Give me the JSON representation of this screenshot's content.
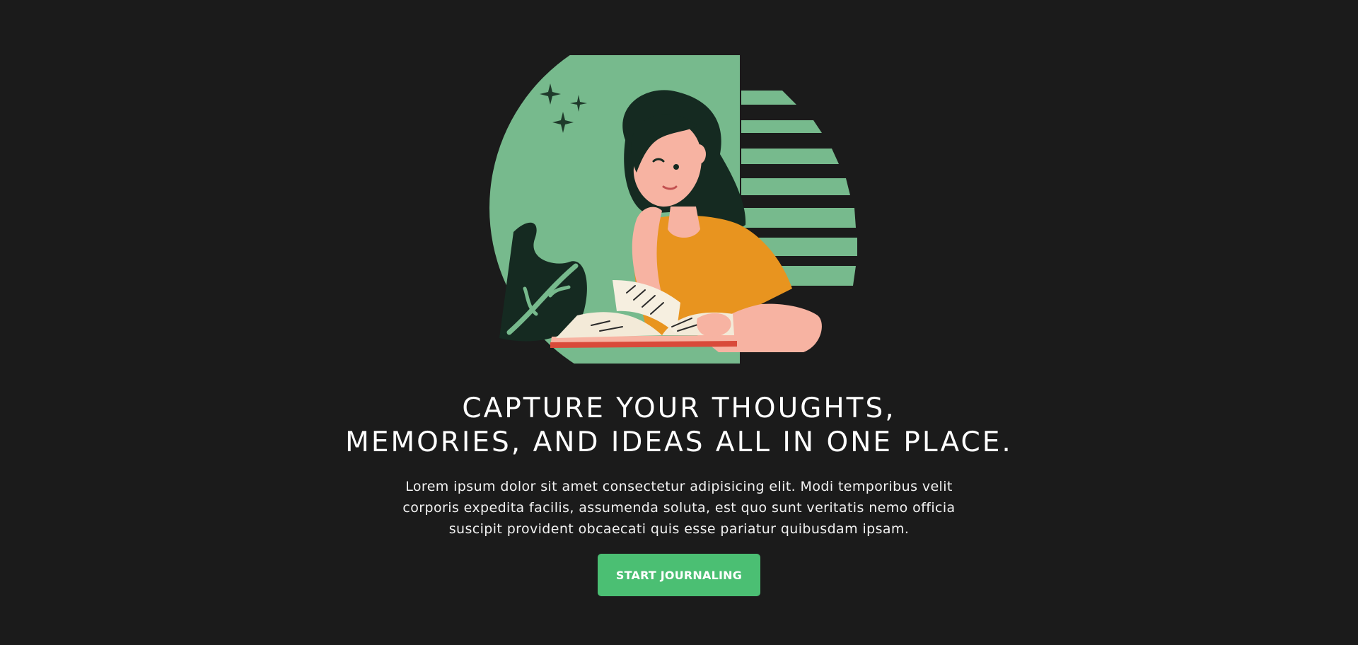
{
  "hero": {
    "headline_line1": "CAPTURE YOUR THOUGHTS,",
    "headline_line2": "MEMORIES, AND IDEAS ALL IN ONE PLACE.",
    "description": "Lorem ipsum dolor sit amet consectetur adipisicing elit. Modi temporibus velit corporis expedita facilis, assumenda soluta, est quo sunt veritatis nemo officia suscipit provident obcaecati quis esse pariatur quibusdam ipsam.",
    "cta_label": "START JOURNALING"
  },
  "illustration": {
    "subject": "woman-reading-journal",
    "icons": [
      "sparkle-icon",
      "leaf-icon"
    ]
  },
  "colors": {
    "background": "#1b1b1b",
    "accent_green": "#4bbf73",
    "circle_green": "#77ba8d",
    "shirt_orange": "#e8941f",
    "skin": "#f7b3a2",
    "hair": "#152a21"
  }
}
